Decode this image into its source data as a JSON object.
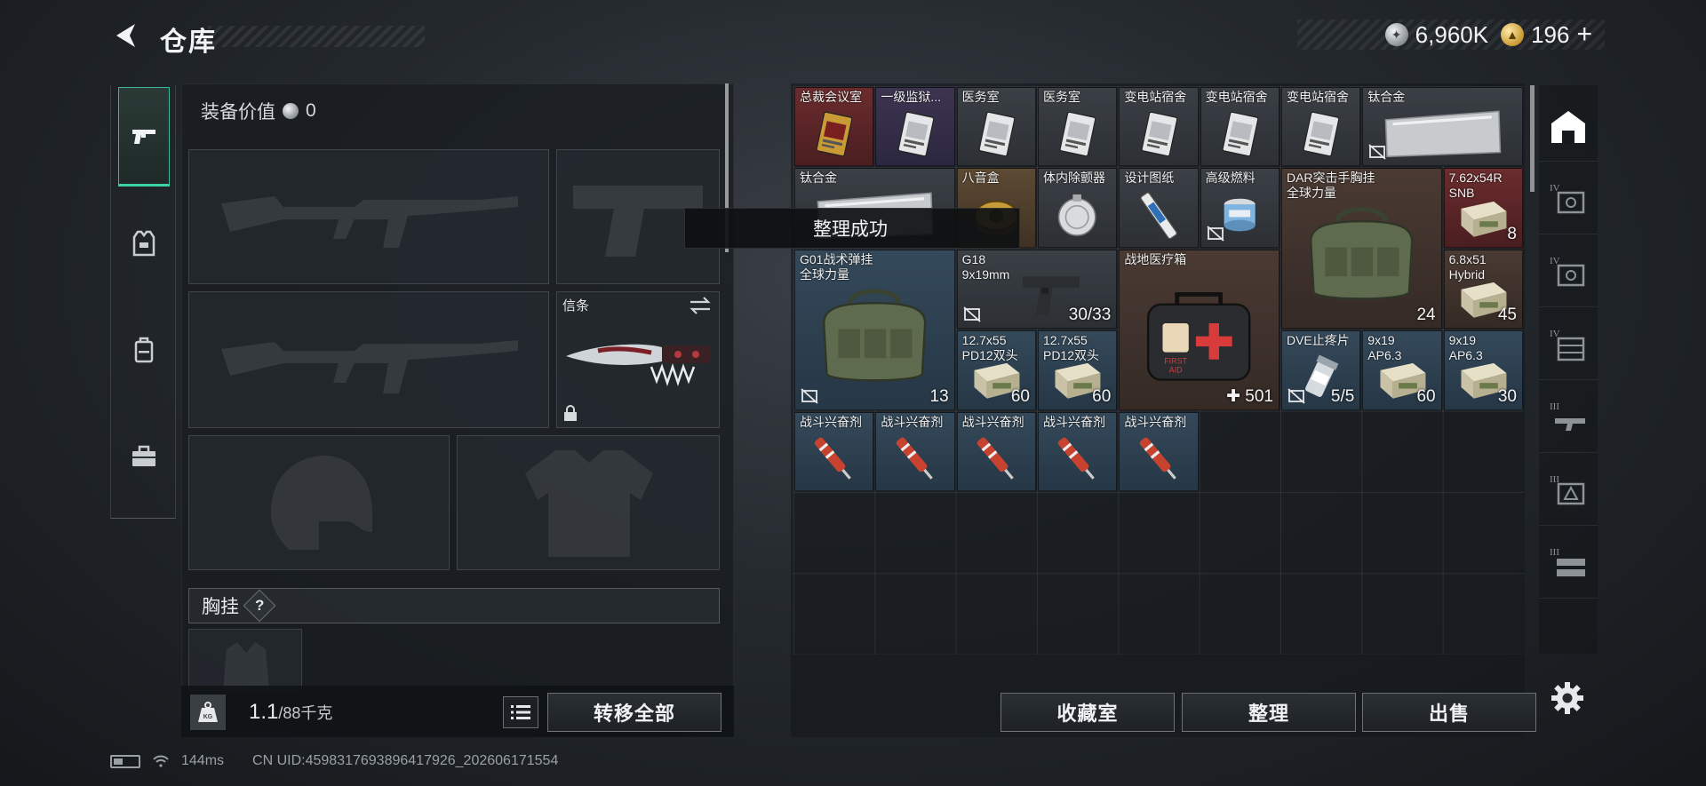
{
  "header": {
    "title": "仓库"
  },
  "currency": {
    "silver": "6,960K",
    "gold": "196",
    "plus": "+"
  },
  "equipment": {
    "value_label": "装备价值",
    "value": "0",
    "beacon_label": "信条",
    "chest_label": "胸挂",
    "help": "?"
  },
  "weight": {
    "current": "1.1",
    "max": "/88千克"
  },
  "buttons": {
    "transfer_all": "转移全部",
    "collection": "收藏室",
    "sort": "整理",
    "sell": "出售"
  },
  "toast": "整理成功",
  "items": [
    {
      "name": "总裁会议室",
      "rarity": "red",
      "icon": "keycard-gold-icon"
    },
    {
      "name": "一级监狱...",
      "rarity": "purple",
      "icon": "keycard-icon"
    },
    {
      "name": "医务室",
      "rarity": "gray",
      "icon": "keycard-icon"
    },
    {
      "name": "医务室",
      "rarity": "gray",
      "icon": "keycard-icon"
    },
    {
      "name": "变电站宿舍",
      "rarity": "gray",
      "icon": "keycard-icon"
    },
    {
      "name": "变电站宿舍",
      "rarity": "gray",
      "icon": "keycard-icon"
    },
    {
      "name": "变电站宿舍",
      "rarity": "gray",
      "icon": "keycard-icon"
    },
    {
      "name": "钛合金",
      "rarity": "gray",
      "icon": "metal-plate-icon"
    },
    {
      "name": "钛合金",
      "rarity": "gray",
      "icon": "metal-plate-icon"
    },
    {
      "name": "八音盒",
      "rarity": "gold",
      "icon": "music-box-icon"
    },
    {
      "name": "体内除颤器",
      "rarity": "gray",
      "icon": "defibrillator-icon"
    },
    {
      "name": "设计图纸",
      "rarity": "gray",
      "icon": "blueprint-icon"
    },
    {
      "name": "高级燃料",
      "rarity": "gray",
      "icon": "fuel-can-icon"
    },
    {
      "name": "DAR突击手胸挂\n全球力量",
      "rarity": "brown",
      "icon": "chest-rig-icon",
      "qty": "24"
    },
    {
      "name": "7.62x54R\nSNB",
      "rarity": "red",
      "icon": "ammo-box-icon",
      "qty": "8"
    },
    {
      "name": "G01战术弹挂\n全球力量",
      "rarity": "blue",
      "icon": "duffel-bag-icon",
      "qty": "13"
    },
    {
      "name": "G18\n9x19mm",
      "rarity": "gray",
      "icon": "pistol-icon",
      "qty": "30/33"
    },
    {
      "name": "战地医疗箱",
      "rarity": "brown",
      "icon": "first-aid-kit-icon",
      "qty": "501",
      "kit_text": "FIRST\nAID"
    },
    {
      "name": "6.8x51\nHybrid",
      "rarity": "brown",
      "icon": "ammo-box-icon",
      "qty": "45"
    },
    {
      "name": "12.7x55\nPD12双头",
      "rarity": "blue",
      "icon": "ammo-box-icon",
      "qty": "60"
    },
    {
      "name": "12.7x55\nPD12双头",
      "rarity": "blue",
      "icon": "ammo-box-icon",
      "qty": "60"
    },
    {
      "name": "DVE止疼片",
      "rarity": "blue",
      "icon": "pill-bottle-icon",
      "qty": "5/5"
    },
    {
      "name": "9x19\nAP6.3",
      "rarity": "blue",
      "icon": "ammo-box-icon",
      "qty": "60"
    },
    {
      "name": "9x19\nAP6.3",
      "rarity": "blue",
      "icon": "ammo-box-icon",
      "qty": "30"
    },
    {
      "name": "战斗兴奋剂",
      "rarity": "blue",
      "icon": "syringe-icon"
    },
    {
      "name": "战斗兴奋剂",
      "rarity": "blue",
      "icon": "syringe-icon"
    },
    {
      "name": "战斗兴奋剂",
      "rarity": "blue",
      "icon": "syringe-icon"
    },
    {
      "name": "战斗兴奋剂",
      "rarity": "blue",
      "icon": "syringe-icon"
    },
    {
      "name": "战斗兴奋剂",
      "rarity": "blue",
      "icon": "syringe-icon"
    }
  ],
  "status": {
    "ping": "144ms",
    "uid": "CN UID:4598317693896417926_202606171554"
  },
  "colors": {
    "accent_green": "#3bd2a8",
    "rarity_red": "#6b2c2e",
    "rarity_gold": "#5d4a34",
    "rarity_purple": "#3d3550",
    "rarity_blue": "#34495a"
  }
}
